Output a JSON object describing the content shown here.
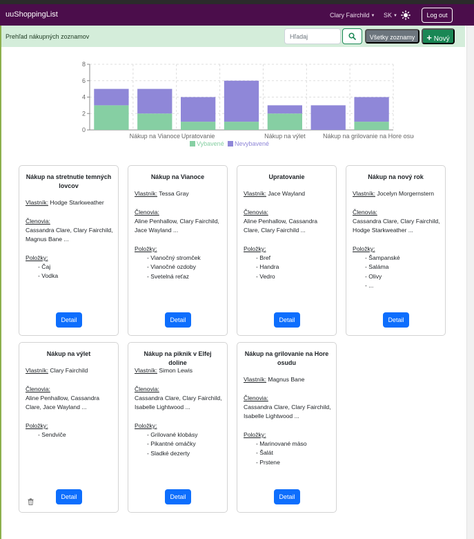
{
  "nav": {
    "brand": "uuShoppingList",
    "user": "Clary Fairchild",
    "lang": "SK",
    "logout": "Log out",
    "icons": [
      "sun-icon",
      "caret-down-icon"
    ]
  },
  "subbar": {
    "title": "Prehľad nákupných zoznamov",
    "search_placeholder": "Hľadaj",
    "search_value": "",
    "all_lists": "Všetky zoznamy",
    "new": "Nový",
    "icons": [
      "search-icon",
      "plus-icon"
    ]
  },
  "colors": {
    "navbar": "#4b0d4b",
    "subbar": "#d4edda",
    "bought": "#86cfa3",
    "not_bought": "#8f87d8",
    "primary": "#0d6efd",
    "success": "#198754",
    "secondary": "#6c757d"
  },
  "chart_data": {
    "type": "bar",
    "stacked": true,
    "categories": [
      "Nákup na stretnutie temných lovcov",
      "Nákup na Vianoce",
      "Upratovanie",
      "Nákup na nový rok",
      "Nákup na výlet",
      "Nákup na piknik v Elfej doline",
      "Nákup na grilovanie na Hore osudu"
    ],
    "tick_labels": [
      "Nákup na Vianoce",
      "Upratovanie",
      "Nákup na výlet",
      "Nákup na grilovanie na Hore osudu"
    ],
    "series": [
      {
        "name": "Vybavené",
        "values": [
          3,
          2,
          1,
          1,
          2,
          0,
          1
        ]
      },
      {
        "name": "Nevybavené",
        "values": [
          2,
          3,
          3,
          5,
          1,
          3,
          3
        ]
      }
    ],
    "y_ticks": [
      "0",
      "2",
      "4",
      "6",
      "8"
    ],
    "ylim": [
      0,
      8
    ],
    "grid": true,
    "legend": "bottom"
  },
  "labels": {
    "owner": "Vlastník:",
    "members": "Členovia:",
    "items": "Položky:",
    "detail": "Detail"
  },
  "cards": [
    {
      "title": [
        "Nákup na stretnutie temných",
        "lovcov"
      ],
      "owner": "Hodge Starkweather",
      "members": [
        "Cassandra Clare, Clary Fairchild,",
        "Magnus Bane ..."
      ],
      "items": [
        "Čaj",
        "Vodka"
      ]
    },
    {
      "title": [
        "Nákup na Vianoce"
      ],
      "owner": "Tessa Gray",
      "members": [
        "Aline Penhallow, Clary Fairchild,",
        "Jace Wayland ..."
      ],
      "items": [
        "Vianočný stromček",
        "Vianočné ozdoby",
        "Svetelná reťaz"
      ]
    },
    {
      "title": [
        "Upratovanie"
      ],
      "owner": "Jace Wayland",
      "members": [
        "Aline Penhallow, Cassandra",
        "Clare, Clary Fairchild ..."
      ],
      "items": [
        "Bref",
        "Handra",
        "Vedro"
      ]
    },
    {
      "title": [
        "Nákup na nový rok"
      ],
      "owner": "Jocelyn Morgernstern",
      "members": [
        "Cassandra Clare, Clary Fairchild,",
        "Hodge Starkweather ..."
      ],
      "items": [
        "Šampanské",
        "Saláma",
        "Olivy",
        "..."
      ]
    },
    {
      "title": [
        "Nákup na výlet"
      ],
      "owner": "Clary Fairchild",
      "members": [
        "Aline Penhallow, Cassandra",
        "Clare, Jace Wayland ..."
      ],
      "items": [
        "Sendviče"
      ],
      "trash_icon": "trash-icon"
    },
    {
      "title": [
        "Nákup na piknik v Elfej doline"
      ],
      "owner": "Simon Lewis",
      "members": [
        "Cassandra Clare, Clary Fairchild,",
        "Isabelle Lightwood ..."
      ],
      "items": [
        "Grilované klobásy",
        "Pikantné omáčky",
        "Sladké dezerty"
      ]
    },
    {
      "title": [
        "Nákup na grilovanie na Hore",
        "osudu"
      ],
      "owner": "Magnus Bane",
      "members": [
        "Cassandra Clare, Clary Fairchild,",
        "Isabelle Lightwood ..."
      ],
      "items": [
        "Marinované mäso",
        "Šalát",
        "Prstene"
      ]
    }
  ]
}
